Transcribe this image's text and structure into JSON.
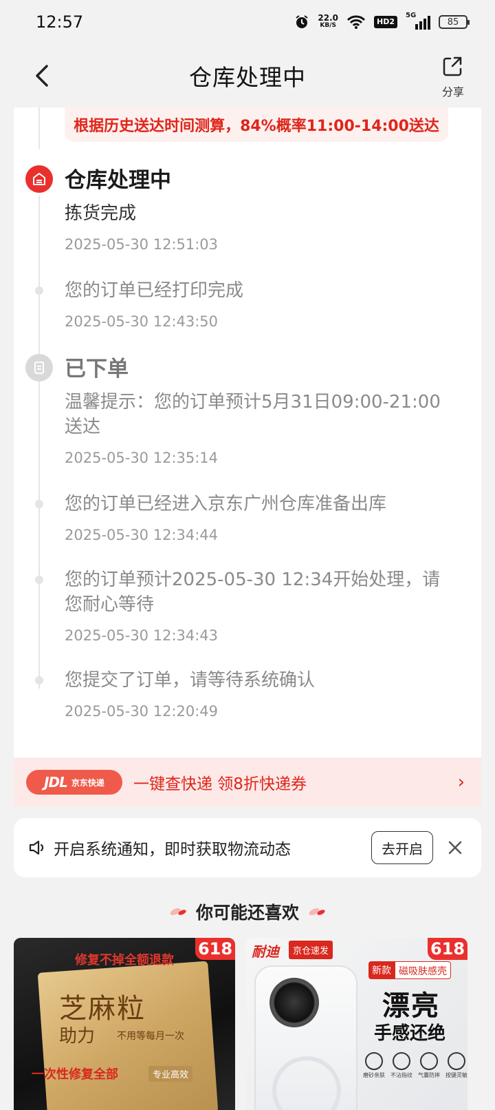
{
  "status_bar": {
    "time": "12:57",
    "net_speed": "22.0",
    "net_speed_unit": "KB/S",
    "hd_label": "HD2",
    "signal_label": "5G",
    "battery": "85"
  },
  "nav": {
    "title": "仓库处理中",
    "share_label": "分享"
  },
  "prediction": "根据历史送达时间测算，84%概率11:00-14:00送达",
  "timeline": [
    {
      "status": "仓库处理中",
      "desc": "拣货完成",
      "time": "2025-05-30 12:51:03"
    },
    {
      "status": "",
      "desc": "您的订单已经打印完成",
      "time": "2025-05-30 12:43:50"
    },
    {
      "status": "已下单",
      "desc": "温馨提示：您的订单预计5月31日09:00-21:00送达",
      "time": "2025-05-30 12:35:14"
    },
    {
      "status": "",
      "desc": "您的订单已经进入京东广州仓库准备出库",
      "time": "2025-05-30 12:34:44"
    },
    {
      "status": "",
      "desc": "您的订单预计2025-05-30 12:34开始处理，请您耐心等待",
      "time": "2025-05-30 12:34:43"
    },
    {
      "status": "",
      "desc": "您提交了订单，请等待系统确认",
      "time": "2025-05-30 12:20:49"
    }
  ],
  "jdl_banner": {
    "logo_big": "JDL",
    "logo_small": "京东快递",
    "text": "一键查快递  领8折快递券",
    "chevron": "›"
  },
  "notify": {
    "text": "开启系统通知，即时获取物流动态",
    "button": "去开启"
  },
  "recommend": {
    "title": "你可能还喜欢",
    "products": [
      {
        "badge": "618",
        "line1": "修复不掉全额退款",
        "line2": "芝麻粒",
        "line3": "助力",
        "line4": "不用等每月一次",
        "line5": "一次性修复全部",
        "line6": "专业高效"
      },
      {
        "badge": "618",
        "brand": "耐迪",
        "ship": "京仓速发",
        "tag_a": "新款",
        "tag_b": "磁吸肤感壳",
        "big1": "漂亮",
        "big2": "手感还绝",
        "features": [
          "磨砂亲肤",
          "不沾指纹",
          "气囊防摔",
          "按键灵敏"
        ]
      }
    ]
  }
}
